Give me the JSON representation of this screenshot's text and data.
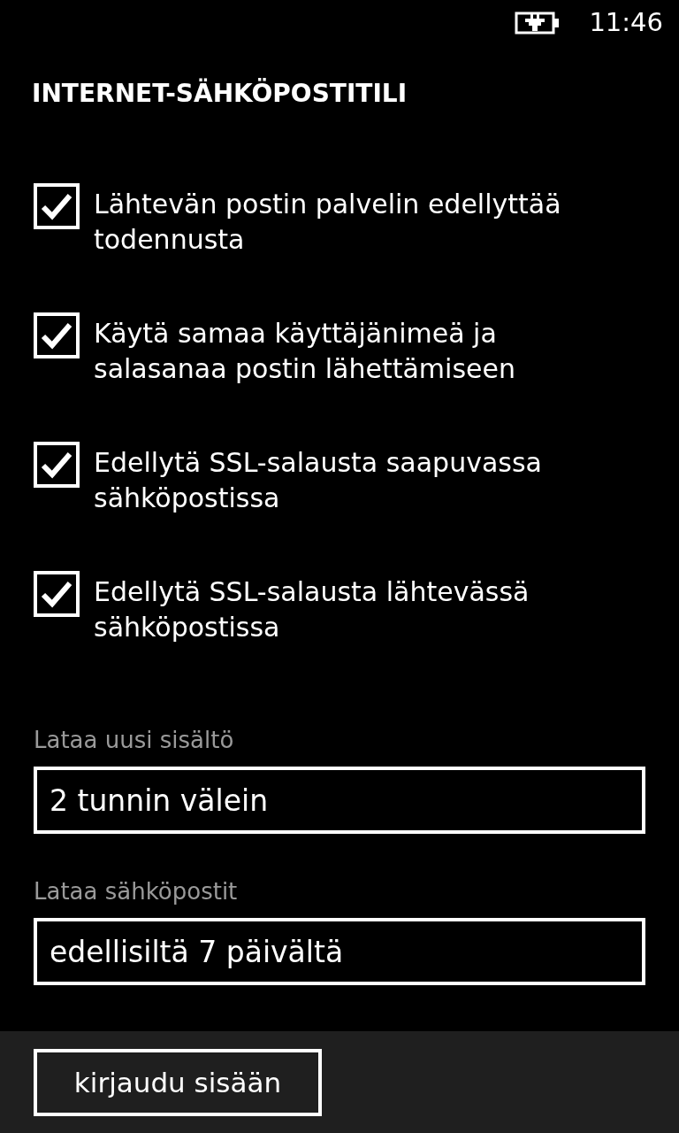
{
  "status_bar": {
    "charging": true,
    "time": "11:46"
  },
  "title": "INTERNET-SÄHKÖPOSTITILI",
  "options": [
    {
      "label": "Lähtevän postin palvelin edellyttää todennusta",
      "checked": true
    },
    {
      "label": "Käytä samaa käyttäjänimeä ja salasanaa postin lähettämiseen",
      "checked": true
    },
    {
      "label": "Edellytä SSL-salausta saapuvassa sähköpostissa",
      "checked": true
    },
    {
      "label": "Edellytä SSL-salausta lähtevässä sähköpostissa",
      "checked": true
    }
  ],
  "fields": [
    {
      "label": "Lataa uusi sisältö",
      "value": "2 tunnin välein"
    },
    {
      "label": "Lataa sähköpostit",
      "value": "edellisiltä 7 päivältä"
    }
  ],
  "app_bar": {
    "button": "kirjaudu sisään"
  }
}
